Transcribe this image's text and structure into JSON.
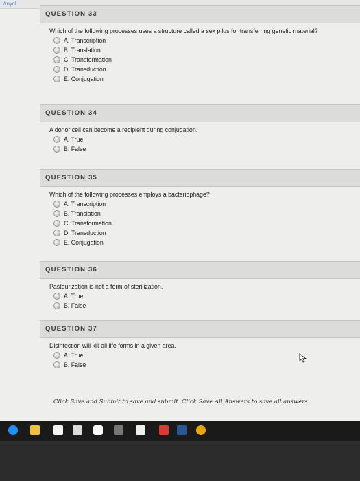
{
  "browser": {
    "url_fragment": "/mycl"
  },
  "questions": [
    {
      "header": "QUESTION 33",
      "text": "Which of the following processes uses a structure called a sex pilus for transferring genetic material?",
      "options": [
        "A. Transcription",
        "B. Translation",
        "C. Transformation",
        "D. Transduction",
        "E. Conjugation"
      ]
    },
    {
      "header": "QUESTION 34",
      "text": "A donor cell can become a recipient during conjugation.",
      "options": [
        "A. True",
        "B. False"
      ]
    },
    {
      "header": "QUESTION 35",
      "text": "Which of the following processes employs a bacteriophage?",
      "options": [
        "A. Transcription",
        "B. Translation",
        "C. Transformation",
        "D. Transduction",
        "E. Conjugation"
      ]
    },
    {
      "header": "QUESTION 36",
      "text": "Pasteurization is not a form of sterilization.",
      "options": [
        "A. True",
        "B. False"
      ]
    },
    {
      "header": "QUESTION 37",
      "text": "Disinfection will kill all life forms in a given area.",
      "options": [
        "A. True",
        "B. False"
      ]
    }
  ],
  "footer": {
    "instructions": "Click Save and Submit to save and submit. Click Save All Answers to save all answers."
  },
  "taskbar": {
    "apps": [
      "edge-icon",
      "explorer-icon",
      "store-icon",
      "amazon-icon",
      "dropbox-icon",
      "link-icon",
      "mail-icon",
      "photos-icon",
      "word-icon",
      "chrome-icon"
    ]
  }
}
